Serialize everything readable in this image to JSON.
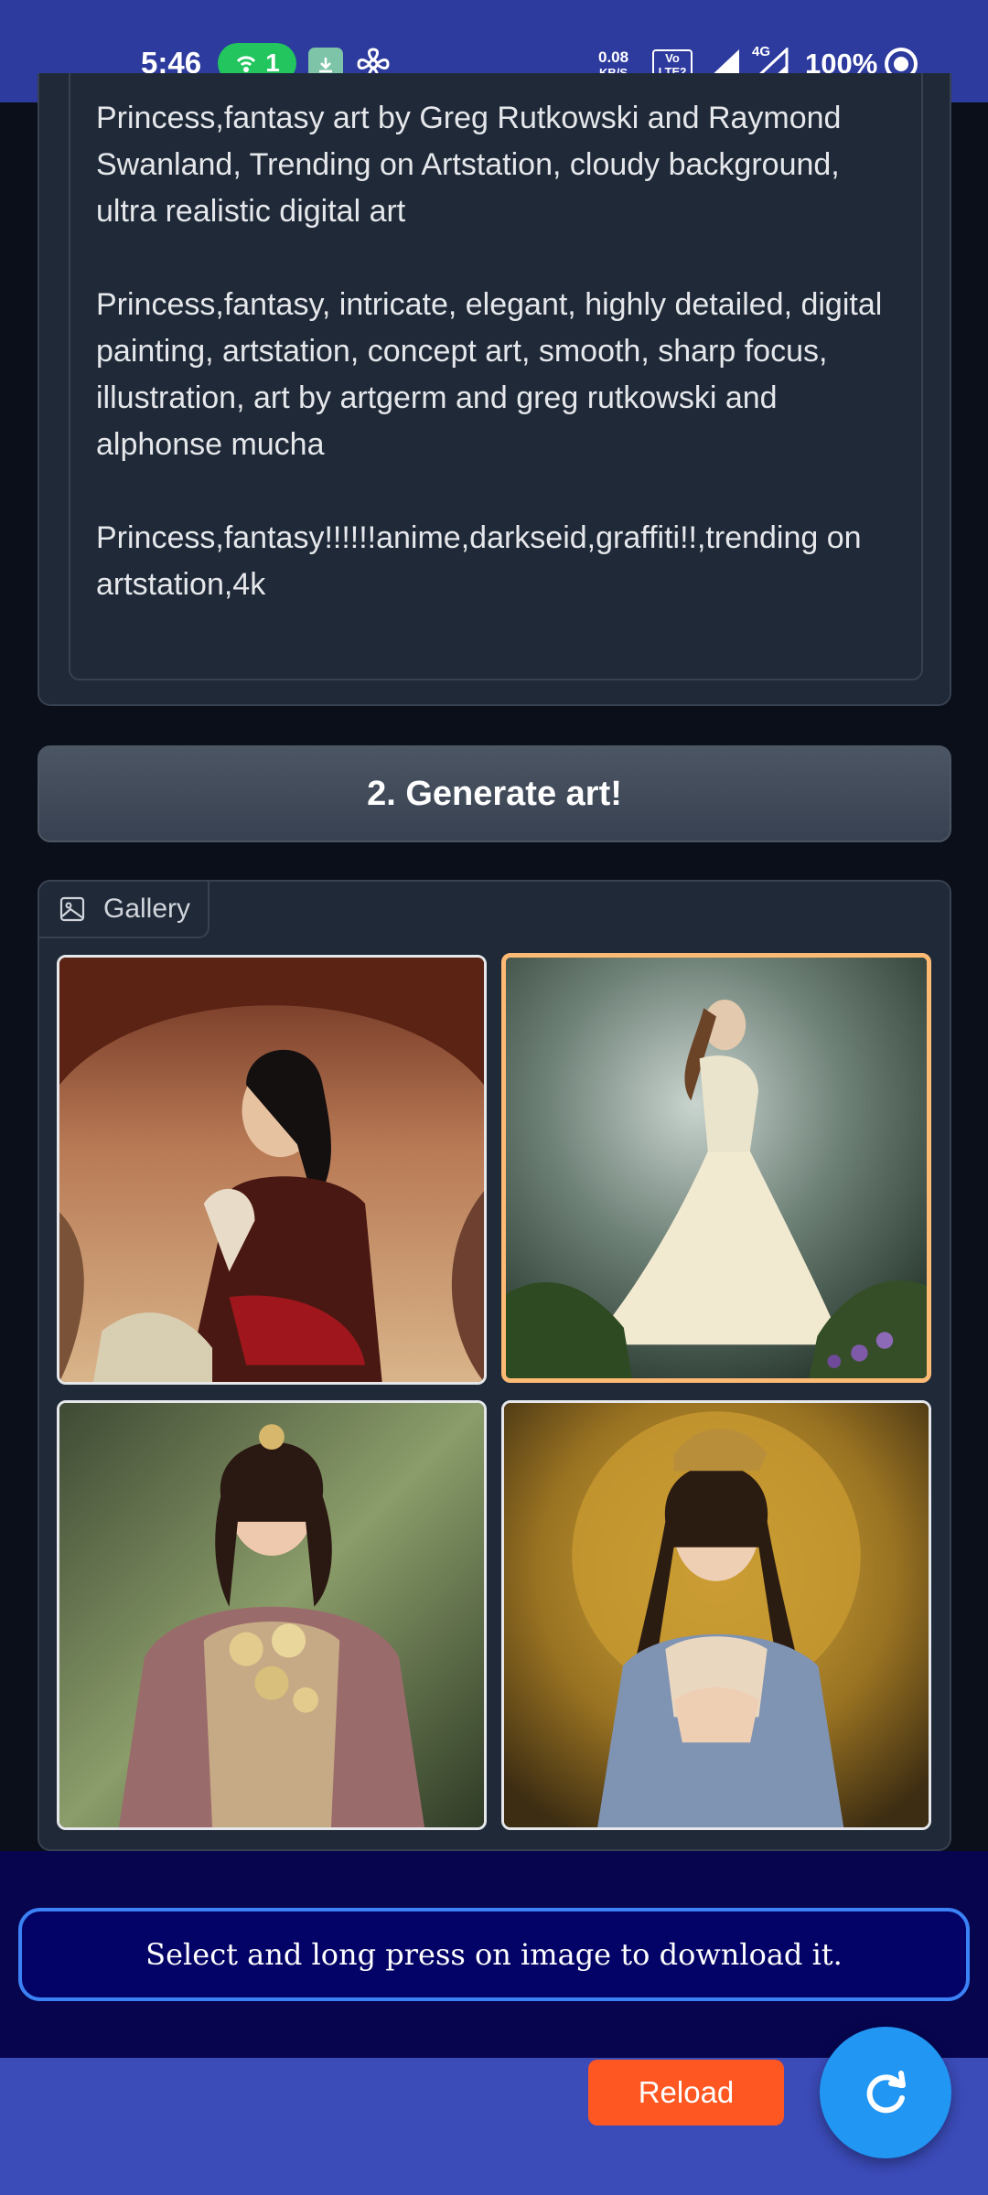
{
  "status_bar": {
    "time": "5:46",
    "hotspot_count": "1",
    "net_speed_value": "0.08",
    "net_speed_unit": "KB/S",
    "volte_top": "Vo",
    "volte_bottom": "LTE2",
    "network_type": "4G",
    "battery": "100%"
  },
  "prompt": {
    "text": "Princess,fantasy art by Greg Rutkowski and Raymond Swanland, Trending on Artstation, cloudy background, ultra realistic digital art\n\nPrincess,fantasy, intricate, elegant, highly detailed, digital painting, artstation, concept art, smooth, sharp focus, illustration, art by artgerm and greg rutkowski and alphonse mucha\n\nPrincess,fantasy!!!!!!anime,darkseid,graffiti!!,trending on artstation,4k"
  },
  "generate_button": {
    "label": "2. Generate art!"
  },
  "gallery": {
    "tab_label": "Gallery",
    "selected_index": 1,
    "images": [
      {
        "icon": "princess-portrait-red-dress"
      },
      {
        "icon": "princess-white-gown-forest"
      },
      {
        "icon": "princess-pink-gown-flowers"
      },
      {
        "icon": "princess-blue-dress-gold"
      }
    ]
  },
  "notice": {
    "text": "Select and long press on image to download it."
  },
  "bottom_bar": {
    "reload_label": "Reload"
  },
  "colors": {
    "status_bar": "#2d3a9e",
    "panel": "#1f2937",
    "selected_border": "#fdba74",
    "reload": "#fe5722",
    "fab": "#2196f3"
  }
}
